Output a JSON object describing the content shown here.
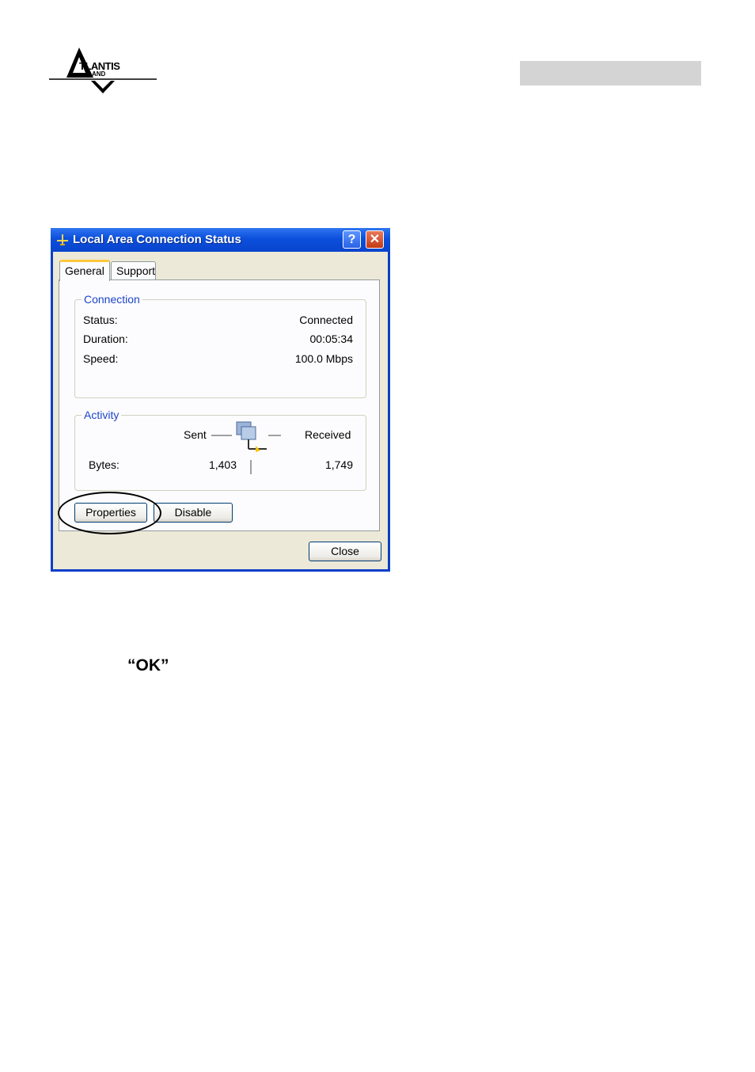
{
  "page": {
    "logo_text": "TLANTIS",
    "logo_sub": "AND",
    "instruction_text": "“OK”"
  },
  "window": {
    "title": "Local Area Connection Status",
    "help_button": "?",
    "close_button_glyph": "✕",
    "tabs": [
      {
        "label": "General",
        "selected": true
      },
      {
        "label": "Support",
        "selected": false
      }
    ],
    "connection": {
      "group_label": "Connection",
      "status_label": "Status:",
      "status_value": "Connected",
      "duration_label": "Duration:",
      "duration_value": "00:05:34",
      "speed_label": "Speed:",
      "speed_value": "100.0 Mbps"
    },
    "activity": {
      "group_label": "Activity",
      "sent_label": "Sent",
      "received_label": "Received",
      "bytes_label": "Bytes:",
      "bytes_sent": "1,403",
      "bytes_received": "1,749"
    },
    "buttons": {
      "properties": "Properties",
      "disable": "Disable",
      "close": "Close"
    }
  },
  "colors": {
    "titlebar": "#0b4fdc",
    "group_label": "#1c45c8",
    "tab_highlight": "#ffc83c",
    "header_bar": "#d4d4d4"
  }
}
